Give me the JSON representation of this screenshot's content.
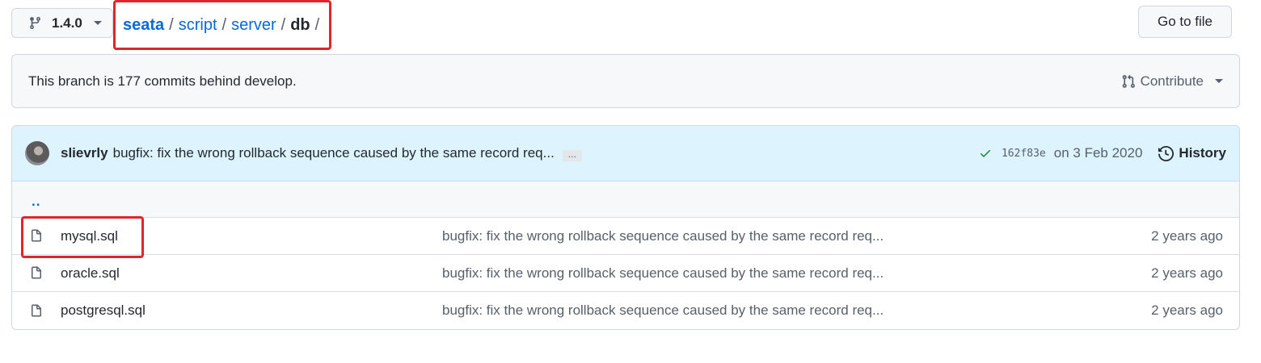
{
  "branch": {
    "name": "1.4.0",
    "icon": "git-branch-icon"
  },
  "breadcrumb": {
    "root": "seata",
    "items": [
      "script",
      "server"
    ],
    "current": "db",
    "sep": "/"
  },
  "toolbar": {
    "goto_label": "Go to file"
  },
  "branch_info": {
    "message": "This branch is 177 commits behind develop.",
    "contribute_label": "Contribute"
  },
  "latest_commit": {
    "author": "slievrly",
    "message": "bugfix: fix the wrong rollback sequence caused by the same record req...",
    "ellipsis": "...",
    "sha": "162f83e",
    "date": "on 3 Feb 2020",
    "history_label": "History",
    "status_color": "#1a7f37"
  },
  "parent_dir": "..",
  "files": [
    {
      "name": "mysql.sql",
      "commit": "bugfix: fix the wrong rollback sequence caused by the same record req...",
      "age": "2 years ago"
    },
    {
      "name": "oracle.sql",
      "commit": "bugfix: fix the wrong rollback sequence caused by the same record req...",
      "age": "2 years ago"
    },
    {
      "name": "postgresql.sql",
      "commit": "bugfix: fix the wrong rollback sequence caused by the same record req...",
      "age": "2 years ago"
    }
  ],
  "colors": {
    "link": "#0969da",
    "highlight": "#e0262a",
    "commit_bg": "#ddf4ff"
  }
}
